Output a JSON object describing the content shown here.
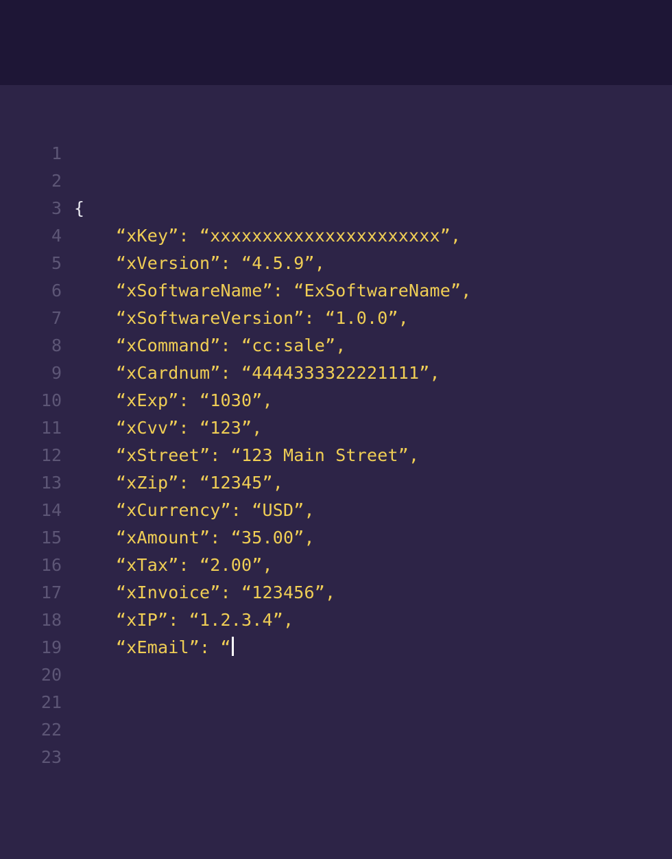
{
  "colors": {
    "topbar": "#1e1636",
    "editor_bg": "#2d2447",
    "gutter": "#5d5676",
    "code": "#f0ce55",
    "brace": "#e7e7ee",
    "cursor": "#ffffff"
  },
  "lines": [
    {
      "num": "1",
      "text": "",
      "style": "code"
    },
    {
      "num": "2",
      "text": "",
      "style": "code"
    },
    {
      "num": "3",
      "text": "{",
      "style": "dim"
    },
    {
      "num": "4",
      "text": "    “xKey”: “xxxxxxxxxxxxxxxxxxxxxx”,",
      "style": "code"
    },
    {
      "num": "5",
      "text": "    “xVersion”: “4.5.9”,",
      "style": "code"
    },
    {
      "num": "6",
      "text": "    “xSoftwareName”: “ExSoftwareName”,",
      "style": "code"
    },
    {
      "num": "7",
      "text": "    “xSoftwareVersion”: “1.0.0”,",
      "style": "code"
    },
    {
      "num": "8",
      "text": "    “xCommand”: “cc:sale”,",
      "style": "code"
    },
    {
      "num": "9",
      "text": "    “xCardnum”: “4444333322221111”,",
      "style": "code"
    },
    {
      "num": "10",
      "text": "    “xExp”: “1030”,",
      "style": "code"
    },
    {
      "num": "11",
      "text": "    “xCvv”: “123”,",
      "style": "code"
    },
    {
      "num": "12",
      "text": "    “xStreet”: “123 Main Street”,",
      "style": "code"
    },
    {
      "num": "13",
      "text": "    “xZip”: “12345”,",
      "style": "code"
    },
    {
      "num": "14",
      "text": "    “xCurrency”: “USD”,",
      "style": "code"
    },
    {
      "num": "15",
      "text": "    “xAmount”: “35.00”,",
      "style": "code"
    },
    {
      "num": "16",
      "text": "    “xTax”: “2.00”,",
      "style": "code"
    },
    {
      "num": "17",
      "text": "    “xInvoice”: “123456”,",
      "style": "code"
    },
    {
      "num": "18",
      "text": "    “xIP”: “1.2.3.4”,",
      "style": "code"
    },
    {
      "num": "19",
      "text": "    “xEmail”: “",
      "style": "code",
      "cursor": true
    },
    {
      "num": "20",
      "text": "",
      "style": "code"
    },
    {
      "num": "21",
      "text": "",
      "style": "code"
    },
    {
      "num": "22",
      "text": "",
      "style": "code"
    },
    {
      "num": "23",
      "text": "",
      "style": "code"
    }
  ]
}
